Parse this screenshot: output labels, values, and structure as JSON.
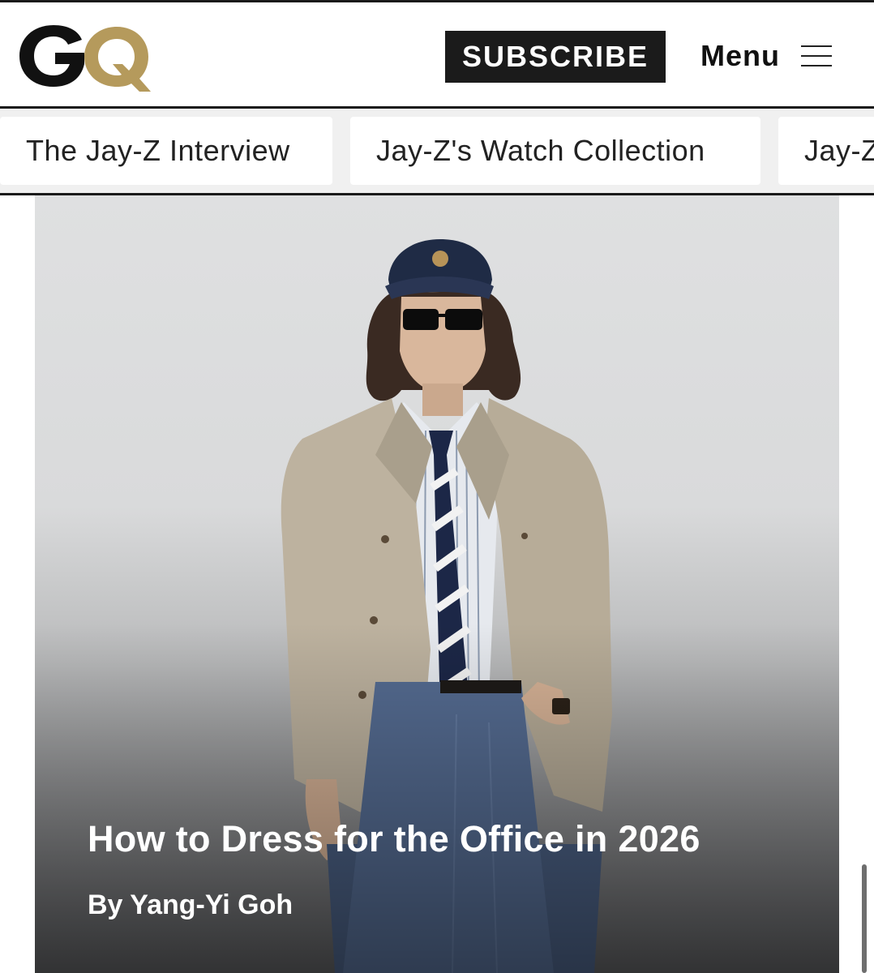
{
  "brand": {
    "logo_text": "GQ",
    "primary_color": "#111111",
    "accent_color": "#b59a5c"
  },
  "header": {
    "subscribe_label": "SUBSCRIBE",
    "menu_label": "Menu",
    "menu_icon": "hamburger-icon"
  },
  "nav": {
    "items": [
      "The Jay-Z Interview",
      "Jay-Z's Watch Collection",
      "Jay-Z"
    ]
  },
  "hero": {
    "title": "How to Dress for the Office in 2026",
    "byline": "By Yang-Yi Goh"
  }
}
